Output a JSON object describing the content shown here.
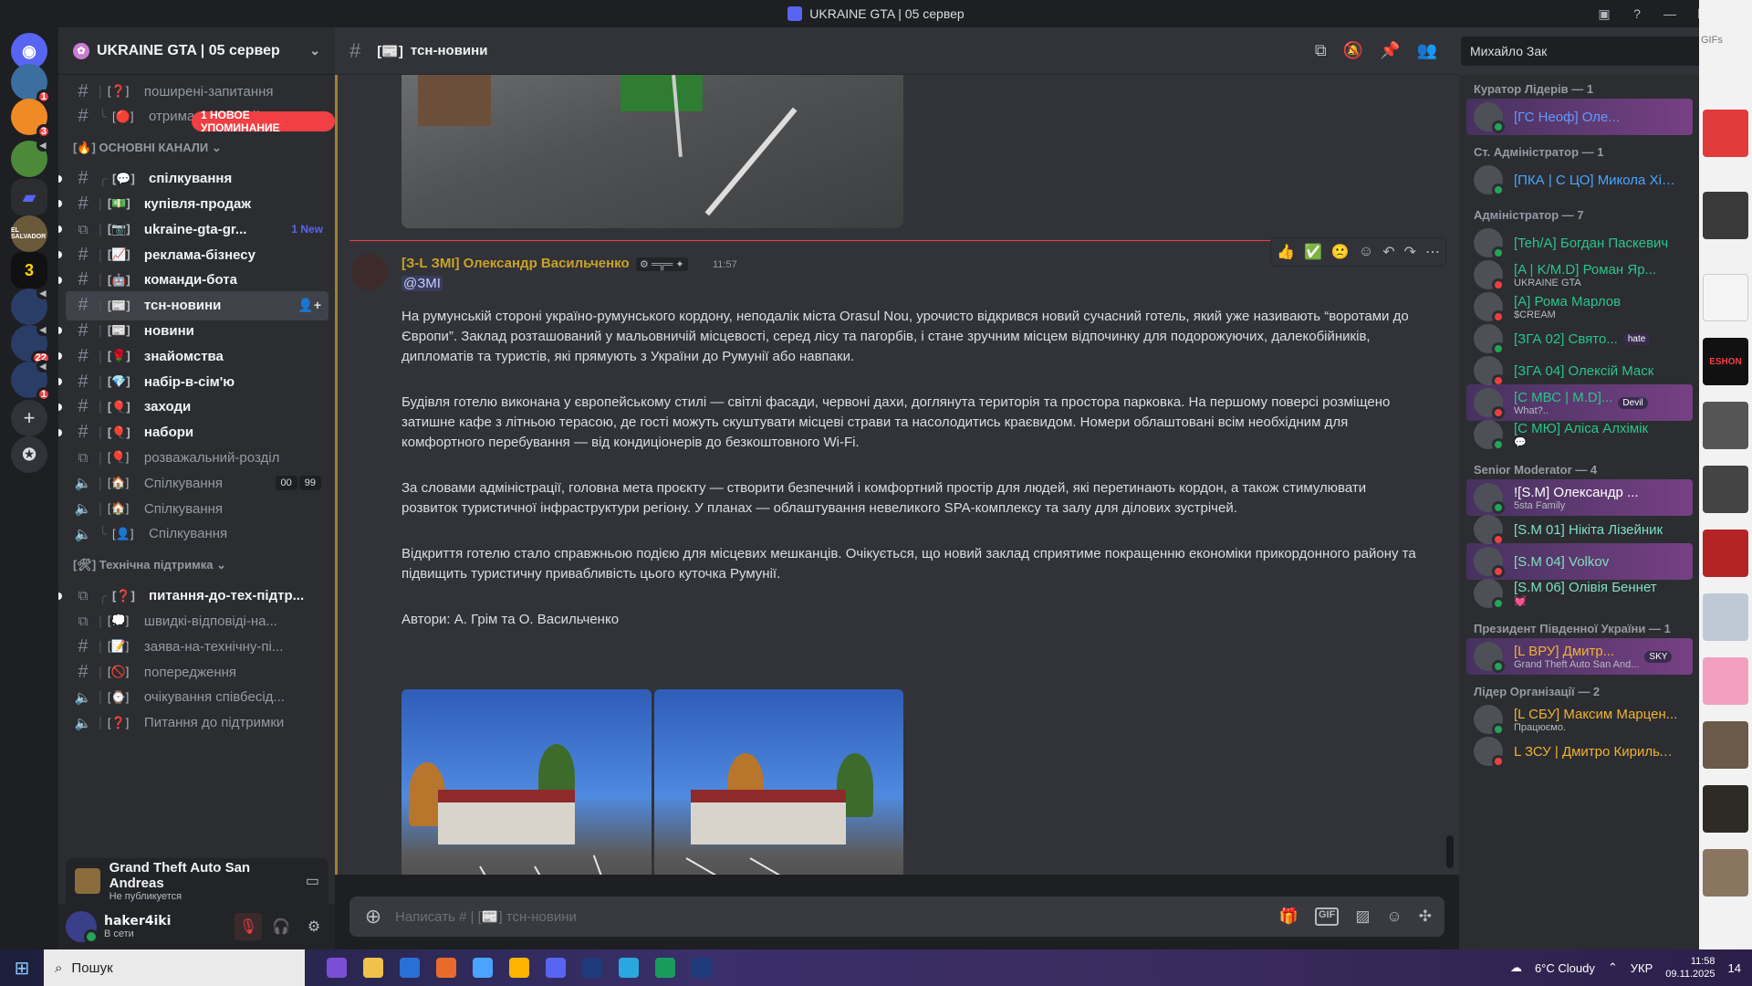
{
  "window": {
    "title": "UKRAINE GTA | 05 сервер"
  },
  "servers": [
    {
      "icon": "server-avatar-1",
      "badge": "1"
    },
    {
      "icon": "server-avatar-2",
      "badge": "3"
    },
    {
      "icon": "server-avatar-3",
      "badge": ""
    },
    {
      "icon": "folder-icon",
      "badge": ""
    },
    {
      "icon": "server-el-salvador",
      "label": "EL SALVADOR",
      "badge": ""
    },
    {
      "icon": "server-3",
      "label": "3",
      "badge": ""
    },
    {
      "icon": "server-avatar-7",
      "badge": ""
    },
    {
      "icon": "server-avatar-8",
      "badge": "22"
    },
    {
      "icon": "server-avatar-9",
      "badge": "1"
    }
  ],
  "sidebar": {
    "guild_name": "UKRAINE GTA | 05 сервер",
    "mention_pill": "1 НОВОЕ УПОМИНАНИЕ",
    "channels_top": [
      {
        "name": "поширені-запитання",
        "emoji": "[❓]"
      },
      {
        "name": "отримання-ролей",
        "emoji": "[🔴]"
      }
    ],
    "category_main": "ОСНОВНІ КАНАЛИ",
    "category_main_emoji": "[🔥]",
    "channels_main": [
      {
        "name": "спілкування",
        "emoji": "[💬]",
        "unread": true,
        "tree": "╭"
      },
      {
        "name": "купівля-продаж",
        "emoji": "[💵]",
        "unread": true,
        "tree": "|"
      },
      {
        "name": "ukraine-gta-gr...",
        "emoji": "[📷]",
        "unread": true,
        "tree": "|",
        "new": "1 New",
        "forum": true
      },
      {
        "name": "реклама-бізнесу",
        "emoji": "[📈]",
        "unread": true,
        "tree": "|"
      },
      {
        "name": "команди-бота",
        "emoji": "[🤖]",
        "unread": true,
        "tree": "|"
      },
      {
        "name": "тсн-новини",
        "emoji": "[📰]",
        "active": true,
        "tree": "|"
      },
      {
        "name": "новини",
        "emoji": "[📰]",
        "unread": true,
        "tree": "|"
      },
      {
        "name": "знайомства",
        "emoji": "[🌹]",
        "unread": true,
        "tree": "|"
      },
      {
        "name": "набір-в-сім'ю",
        "emoji": "[💎]",
        "unread": true,
        "tree": "|"
      },
      {
        "name": "заходи",
        "emoji": "[🎈]",
        "unread": true,
        "tree": "|"
      },
      {
        "name": "набори",
        "emoji": "[🎈]",
        "unread": true,
        "tree": "|"
      },
      {
        "name": "розважальний-розділ",
        "emoji": "[🎈]",
        "tree": "|",
        "forum": true
      },
      {
        "name": "Спілкування",
        "emoji": "[🏠]",
        "tree": "|",
        "voice": true,
        "vc": [
          "00",
          "99"
        ]
      },
      {
        "name": "Спілкування",
        "emoji": "[🏠]",
        "tree": "|",
        "voice": true
      },
      {
        "name": "Спілкування",
        "emoji": "[👤]",
        "tree": "╰",
        "voice": true
      }
    ],
    "category_support": "Технічна підтримка",
    "category_support_emoji": "[🛠]",
    "channels_support": [
      {
        "name": "питання-до-тех-підтр...",
        "emoji": "[❓]",
        "unread": true,
        "tree": "╭",
        "forum": true
      },
      {
        "name": "швидкі-відповіді-на...",
        "emoji": "[💭]",
        "tree": "|",
        "forum": true
      },
      {
        "name": "заява-на-технічну-пі...",
        "emoji": "[📝]",
        "tree": "|"
      },
      {
        "name": "попередження",
        "emoji": "[🚫]",
        "tree": "|"
      },
      {
        "name": "очікування співбесід...",
        "emoji": "[⌚]",
        "tree": "|",
        "voice": true
      },
      {
        "name": "Питання до підтримки",
        "emoji": "[❓]",
        "tree": "|",
        "voice": true
      }
    ],
    "activity": {
      "game": "Grand Theft Auto San Andreas",
      "status": "Не публикуется"
    },
    "user": {
      "name": "haker4iki",
      "status": "В сети"
    }
  },
  "chat": {
    "channel_name": "тсн-новини",
    "channel_prefix": "[📰]",
    "search_value": "Михайло Зак",
    "message": {
      "author": "[З-L ЗМІ] Олександр Васильченко",
      "tag": "⚙ ═╦═ ✦",
      "time": "11:57",
      "mention": "@ЗМІ",
      "paragraphs": [
        "На румунській стороні україно-румунського кордону, неподалік міста Orasul Nou, урочисто відкрився новий сучасний готель, який уже називають “воротами до Європи”. Заклад розташований у мальовничій місцевості, серед лісу та пагорбів, і стане зручним місцем відпочинку для подорожуючих, далекобійників, дипломатів та туристів, які прямують з України до Румунії або навпаки.",
        "Будівля готелю виконана у європейському стилі — світлі фасади, червоні дахи, доглянута територія та простора парковка. На першому поверсі розміщено затишне кафе з літньою терасою, де гості можуть скуштувати місцеві страви та насолодитись краєвидом. Номери облаштовані всім необхідним для комфортного перебування — від кондиціонерів до безкоштовного Wi-Fi.",
        "За словами адміністрації, головна мета проєкту — створити безпечний і комфортний простір для людей, які перетинають кордон, а також стимулювати розвиток туристичної інфраструктури регіону. У планах — облаштування невеликого SPA-комплексу та залу для ділових зустрічей.",
        "Відкриття готелю стало справжньою подією для місцевих мешканців. Очікується, що новий заклад сприятиме покращенню економіки прикордонного району та підвищить туристичну привабливість цього куточка Румунії.",
        "Автори: А. Грім та О. Васильченко"
      ]
    },
    "composer_placeholder": "Написать # | [📰] тсн-новини"
  },
  "members": {
    "groups": [
      {
        "label": "Куратор Лідерів — 1",
        "items": [
          {
            "name": "[ГС Неоф] Оле...",
            "color": "#5e9bff",
            "boost": true
          }
        ]
      },
      {
        "label": "Ст. Адміністратор — 1",
        "items": [
          {
            "name": "[ПКА | С ЦО] Микола Хімік",
            "color": "#4aa6ff"
          }
        ]
      },
      {
        "label": "Адміністратор — 7",
        "items": [
          {
            "name": "[Teh/A] Богдан Паскевич",
            "color": "#2bc48a"
          },
          {
            "name": "[A | K/M.D] Роман Яр...",
            "sub": "UKRAINE GTA",
            "color": "#2bc48a"
          },
          {
            "name": "[A] Рома Марлов",
            "sub": "$CREAM",
            "color": "#2bc48a"
          },
          {
            "name": "[ЗГА 02] Свято...",
            "color": "#2bc48a",
            "badge": "hate"
          },
          {
            "name": "[ЗГА 04] Олексій Маск",
            "color": "#2bc48a"
          },
          {
            "name": "[С МВС | M.D]...",
            "sub": "What?..",
            "color": "#2bc48a",
            "badge": "Devil",
            "boost": true
          },
          {
            "name": "[С МЮ] Аліса Алхімік",
            "sub": "💬",
            "color": "#2bc48a"
          }
        ]
      },
      {
        "label": "Senior Moderator — 4",
        "items": [
          {
            "name": "![S.M] Олександр ...",
            "sub": "5sta Family",
            "color": "#ffffff",
            "boost": true
          },
          {
            "name": "[S.M 01] Нікіта Лізейник",
            "color": "#7fe0c0"
          },
          {
            "name": "[S.M 04] Volkov",
            "color": "#7fe0c0",
            "boost": true
          },
          {
            "name": "[S.M 06] Олівія Беннет",
            "sub": "💓",
            "color": "#7fe0c0"
          }
        ]
      },
      {
        "label": "Президент Південної України — 1",
        "items": [
          {
            "name": "[L ВРУ] Дмитр...",
            "sub": "Grand Theft Auto San And...",
            "color": "#f0b232",
            "badge": "SKY",
            "boost": true
          }
        ]
      },
      {
        "label": "Лідер Організації — 2",
        "items": [
          {
            "name": "[L СБУ] Максим Марцен...",
            "sub": "Працюємо.",
            "color": "#f0b232"
          },
          {
            "name": "L ЗСУ | Дмитро Кирильчук",
            "color": "#f0b232"
          }
        ]
      }
    ]
  },
  "bgwindow": {
    "tab_label": "GIFs",
    "logo_text": "ESHON"
  },
  "taskbar": {
    "search_placeholder": "Пошук",
    "weather": "6°C  Cloudy",
    "lang": "УКР",
    "time": "11:58",
    "date": "09.11.2025",
    "notif": "14"
  }
}
